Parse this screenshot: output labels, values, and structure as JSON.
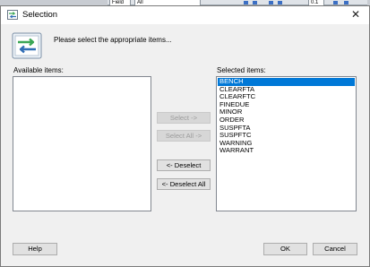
{
  "background_app": {
    "toolbar_field_1": "Field",
    "toolbar_field_2": "All",
    "toolbar_field_3": "0.1"
  },
  "dialog": {
    "title": "Selection",
    "close_glyph": "✕",
    "prompt": "Please select the appropriate items...",
    "available_label": "Available items:",
    "selected_label": "Selected items:",
    "available_items": [],
    "selected_items": [
      "BENCH",
      "CLEARFTA",
      "CLEARFTC",
      "FINEDUE",
      "MINOR",
      "ORDER",
      "SUSPFTA",
      "SUSPFTC",
      "WARNING",
      "WARRANT"
    ],
    "highlighted_item": "BENCH",
    "buttons": {
      "select": "Select ->",
      "select_all": "Select All ->",
      "deselect": "<- Deselect",
      "deselect_all": "<- Deselect All",
      "help": "Help",
      "ok": "OK",
      "cancel": "Cancel"
    },
    "button_states": {
      "select_enabled": false,
      "select_all_enabled": false
    },
    "colors": {
      "selection_highlight": "#0078d7",
      "dialog_background": "#f0f0f0",
      "icon_green": "#3aa655",
      "icon_blue": "#2f6db5"
    },
    "icons": {
      "title_icon": "selection-app-icon",
      "header_icon": "swap-arrows-icon",
      "close": "close-icon"
    }
  }
}
